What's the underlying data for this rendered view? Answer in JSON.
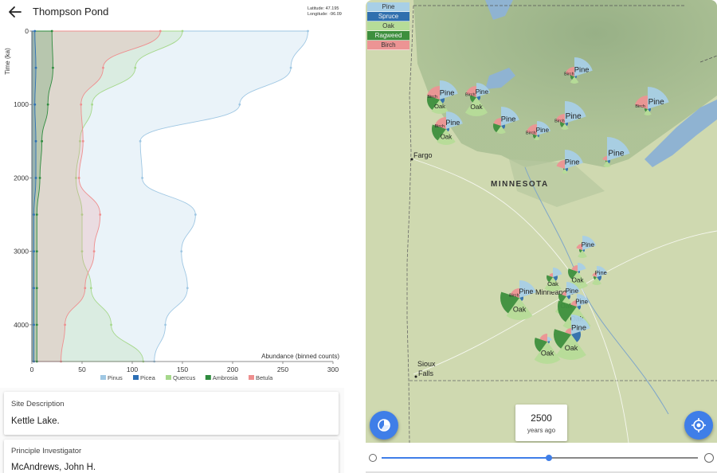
{
  "header": {
    "title": "Thompson Pond",
    "latitude_label": "Latitude: 47.195",
    "longitude_label": "Longitude: -96.09"
  },
  "chart_data": {
    "type": "area",
    "ylabel": "Time (ka)",
    "xlabel": "Abundance (binned counts)",
    "xlim": [
      0,
      300
    ],
    "ylim": [
      0,
      4500
    ],
    "x_ticks": [
      "0",
      "50",
      "100",
      "150",
      "200",
      "250",
      "300"
    ],
    "y_ticks": [
      "0",
      "1000",
      "2000",
      "3000",
      "4000"
    ],
    "legend_position": "bottom",
    "depth": [
      0,
      500,
      1000,
      1500,
      2000,
      2500,
      3000,
      3500,
      4000,
      4500
    ],
    "series": [
      {
        "name": "Picea",
        "color": "#2c6fb5",
        "values": [
          3,
          4,
          3,
          4,
          4,
          2,
          2,
          2,
          2,
          2
        ]
      },
      {
        "name": "Ambrosia",
        "color": "#2e8b3e",
        "values": [
          20,
          21,
          16,
          10,
          8,
          5,
          5,
          5,
          5,
          5
        ]
      },
      {
        "name": "Betula",
        "color": "#ee8f8f",
        "values": [
          128,
          71,
          49,
          51,
          47,
          68,
          62,
          53,
          33,
          29
        ]
      },
      {
        "name": "Quercus",
        "color": "#a6d88c",
        "values": [
          150,
          103,
          60,
          48,
          44,
          50,
          50,
          59,
          79,
          111
        ]
      },
      {
        "name": "Pinus",
        "color": "#9fc7e3",
        "values": [
          275,
          258,
          207,
          108,
          110,
          163,
          149,
          155,
          133,
          122
        ]
      }
    ],
    "legend_order": [
      "Pinus",
      "Picea",
      "Quercus",
      "Ambrosia",
      "Betula"
    ]
  },
  "cards": [
    {
      "label": "Site Description",
      "value": "Kettle Lake."
    },
    {
      "label": "Principle Investigator",
      "value": "McAndrews, John H."
    }
  ],
  "map": {
    "legend": [
      {
        "label": "Pine",
        "color": "#a8cfe6"
      },
      {
        "label": "Spruce",
        "color": "#2f6fae"
      },
      {
        "label": "Oak",
        "color": "#b6dc98"
      },
      {
        "label": "Ragweed",
        "color": "#3d8f3d"
      },
      {
        "label": "Birch",
        "color": "#ec9494"
      }
    ],
    "labels": {
      "state": "MINNESOTA",
      "city_fargo": "Fargo",
      "city_sioux_1": "Sioux",
      "city_sioux_2": "Falls",
      "city_minneapolis": "Minneapolis"
    },
    "time": {
      "value": "2500",
      "unit": "years ago"
    },
    "slider": {
      "fraction": 0.53
    },
    "icons": {
      "left_fab": "pie-chart-icon",
      "right_fab": "my-location-icon",
      "min": "info-icon",
      "max": "info-icon"
    }
  }
}
